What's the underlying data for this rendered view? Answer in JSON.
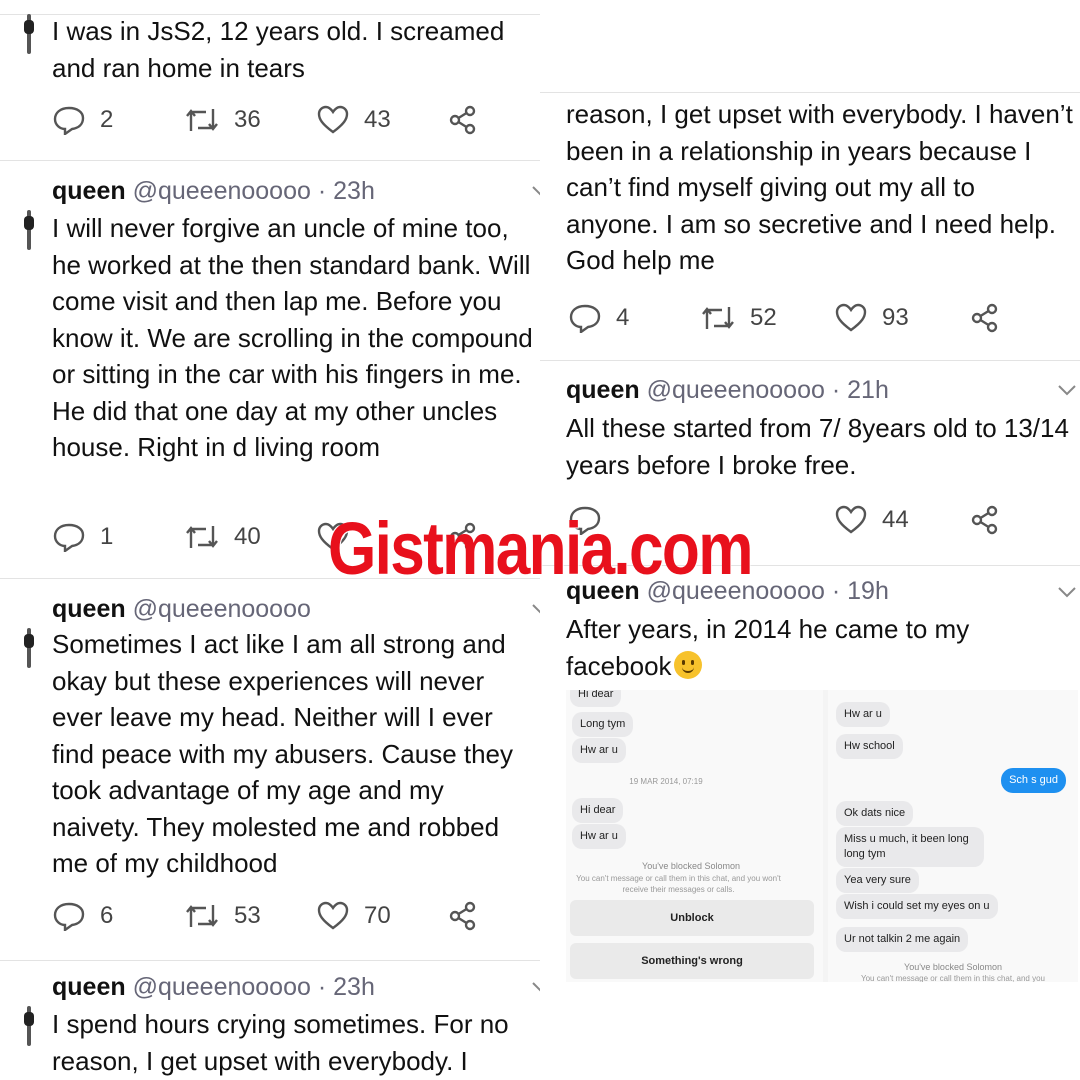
{
  "left_column": {
    "tweet0": {
      "text": "I was in JsS2, 12 years old. I screamed and ran home in tears",
      "replies": "2",
      "retweets": "36",
      "likes": "43"
    },
    "tweet1": {
      "name": "queen",
      "handle": "@queeenooooo",
      "dot": "·",
      "time": "23h",
      "text": "I will never forgive an uncle of mine too, he worked at the then standard bank. Will come visit and then lap me. Before you know it. We are scrolling in the compound or sitting in the car with his fingers in me. He did that one day at my other uncles house. Right in d living room",
      "replies": "1",
      "retweets": "40"
    },
    "tweet2": {
      "name": "queen",
      "handle": "@queeenooooo",
      "text": "Sometimes I act like I am all strong and okay but these experiences will never ever leave my head. Neither will I ever find peace with my abusers. Cause they took advantage of my age and my naivety. They molested me and robbed me of my childhood",
      "replies": "6",
      "retweets": "53",
      "likes": "70"
    },
    "tweet3": {
      "name": "queen",
      "handle": "@queeenooooo",
      "dot": "·",
      "time": "23h",
      "text": "I spend hours crying sometimes. For no reason, I get upset with everybody. I"
    }
  },
  "right_column": {
    "tweet_cont": {
      "text": "reason, I get upset with everybody. I haven’t been in a relationship in years because I can’t find myself giving out my all to anyone. I am so secretive and I need help. God help me",
      "replies": "4",
      "retweets": "52",
      "likes": "93"
    },
    "tweet4": {
      "name": "queen",
      "handle": "@queeenooooo",
      "dot": "·",
      "time": "21h",
      "text": "All these started from 7/ 8years old to 13/14 years before I broke free.",
      "likes": "44"
    },
    "tweet5": {
      "name": "queen",
      "handle": "@queeenooooo",
      "dot": "·",
      "time": "19h",
      "text": "After years, in 2014 he came to my facebook"
    }
  },
  "chat": {
    "left": {
      "top_cut": "Hi dear",
      "msgs": [
        "Long tym",
        "Hw ar u"
      ],
      "date": "19 MAR 2014, 07:19",
      "msgs2": [
        "Hi dear",
        "Hw ar u"
      ],
      "blocked_title": "You've blocked Solomon",
      "blocked_sub": "You can't message or call them in this chat, and you won't receive their messages or calls.",
      "unblock": "Unblock",
      "wrong": "Something's wrong"
    },
    "right": {
      "msgs": [
        "Hw ar u",
        "Hw school"
      ],
      "me": "Sch s gud",
      "msgs2": [
        "Ok dats nice",
        "Miss u much, it been long long tym",
        "Yea very sure",
        "Wish i could set my eyes on u",
        "Ur not talkin 2 me again"
      ],
      "blocked_title": "You've blocked Solomon",
      "blocked_sub": "You can't message or call them in this chat, and you"
    }
  },
  "watermark": "Gistmania.com",
  "colors": {
    "watermark": "#e8101c",
    "secondary_text": "#667788",
    "sent_bubble": "#1e90f0"
  },
  "icons": [
    "reply-icon",
    "retweet-icon",
    "like-icon",
    "share-icon",
    "chevron-down-icon",
    "avatar-icon",
    "smiley-emoji"
  ]
}
